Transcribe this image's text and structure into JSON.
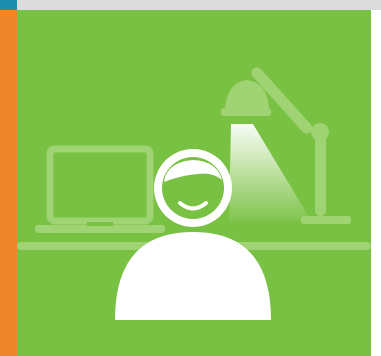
{
  "colors": {
    "panel_background": "#79c142",
    "side_accent": "#f0862a",
    "top_accent": "#1c8fb0",
    "top_bar": "#dcdcdc",
    "silhouette": "#9fd374",
    "person": "#ffffff"
  },
  "icons": {
    "illustration": "person-at-desk-with-laptop-and-lamp",
    "person": "user-avatar-icon",
    "laptop": "laptop-icon",
    "lamp": "desk-lamp-icon"
  }
}
